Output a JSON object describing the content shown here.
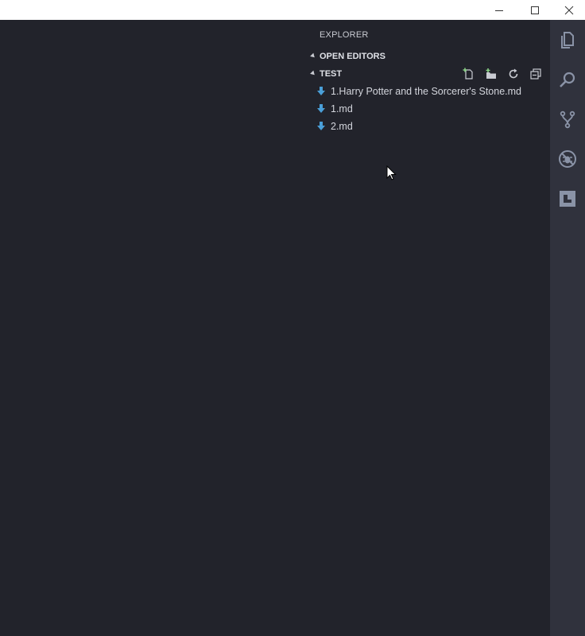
{
  "window": {
    "controls": [
      "minimize",
      "maximize",
      "close"
    ]
  },
  "sidebar": {
    "title": "EXPLORER",
    "open_editors": {
      "label": "OPEN EDITORS"
    },
    "folder": {
      "label": "TEST",
      "actions": [
        "new-file",
        "new-folder",
        "refresh",
        "collapse-all"
      ],
      "files": [
        {
          "name": "1.Harry Potter and the Sorcerer's Stone.md",
          "icon": "markdown-icon"
        },
        {
          "name": "1.md",
          "icon": "markdown-icon"
        },
        {
          "name": "2.md",
          "icon": "markdown-icon"
        }
      ]
    }
  },
  "activitybar": {
    "items": [
      "explorer",
      "search",
      "source-control",
      "debug",
      "extensions"
    ]
  },
  "colors": {
    "background": "#22232b",
    "activitybar": "#30323d",
    "markdown_icon": "#4a9fd8",
    "action_icon": "#b6e07a",
    "activity_icon": "#8a93a7"
  }
}
